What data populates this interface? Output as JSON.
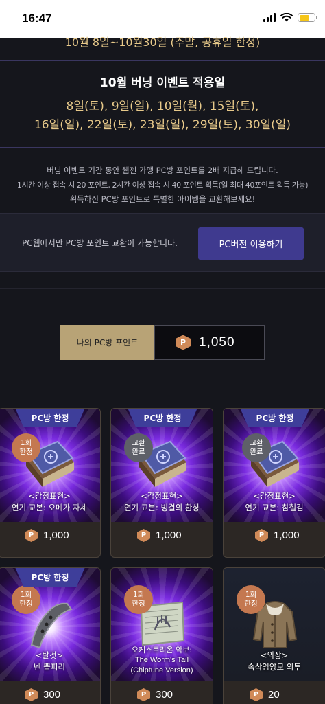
{
  "status": {
    "time": "16:47"
  },
  "top_cut": "10월 8일~10월30일 (주말, 공휴일 한정)",
  "burning": {
    "title": "10월 버닝 이벤트 적용일",
    "dates_line1": "8일(토), 9일(일), 10일(월), 15일(토),",
    "dates_line2": "16일(일), 22일(토), 23일(일), 29일(토), 30일(일)"
  },
  "info": {
    "line1": "버닝 이벤트 기간 동안 웹젠 가맹 PC방 포인트를 2배 지급해 드립니다.",
    "line2": "1시간 이상 접속 시 20 포인트, 2시간 이상 접속 시 40 포인트 획득(일 최대 40포인트 획득 가능)",
    "line3": "획득하신 PC방 포인트로 특별한 아이템을 교환해보세요!"
  },
  "pcweb": {
    "text": "PC웹에서만 PC방 포인트 교환이 가능합니다.",
    "button": "PC버전 이용하기"
  },
  "points": {
    "label": "나의 PC방 포인트",
    "coin": "P",
    "value": "1,050"
  },
  "coin_symbol": "P",
  "items": [
    {
      "tag": "PC방 한정",
      "badge1": "1회",
      "badge2": "한정",
      "badge_state": "limit",
      "name1": "<감정표현>",
      "name2": "연기 교본: 오메가 자세",
      "price": "1,000",
      "icon": "book-icon"
    },
    {
      "tag": "PC방 한정",
      "badge1": "교환",
      "badge2": "완료",
      "badge_state": "done",
      "name1": "<감정표현>",
      "name2": "연기 교본: 빙결의 환상",
      "price": "1,000",
      "icon": "book-icon"
    },
    {
      "tag": "PC방 한정",
      "badge1": "교환",
      "badge2": "완료",
      "badge_state": "done",
      "name1": "<감정표현>",
      "name2": "연기 교본: 참철검",
      "price": "1,000",
      "icon": "book-icon"
    },
    {
      "tag": "PC방 한정",
      "badge1": "1회",
      "badge2": "한정",
      "badge_state": "limit",
      "name1": "<탈것>",
      "name2": "넨 뿔피리",
      "price": "300",
      "icon": "horn-icon"
    },
    {
      "tag": "",
      "badge1": "1회",
      "badge2": "한정",
      "badge_state": "limit",
      "name1": "오케스트리온 악보:",
      "name2": "The Worm's Tail",
      "name3": "(Chiptune Version)",
      "price": "300",
      "icon": "music-sheet-icon"
    },
    {
      "tag": "",
      "badge1": "1회",
      "badge2": "한정",
      "badge_state": "limit",
      "name1": "<의상>",
      "name2": "속삭임양모 외투",
      "price": "20",
      "icon": "coat-icon"
    }
  ]
}
